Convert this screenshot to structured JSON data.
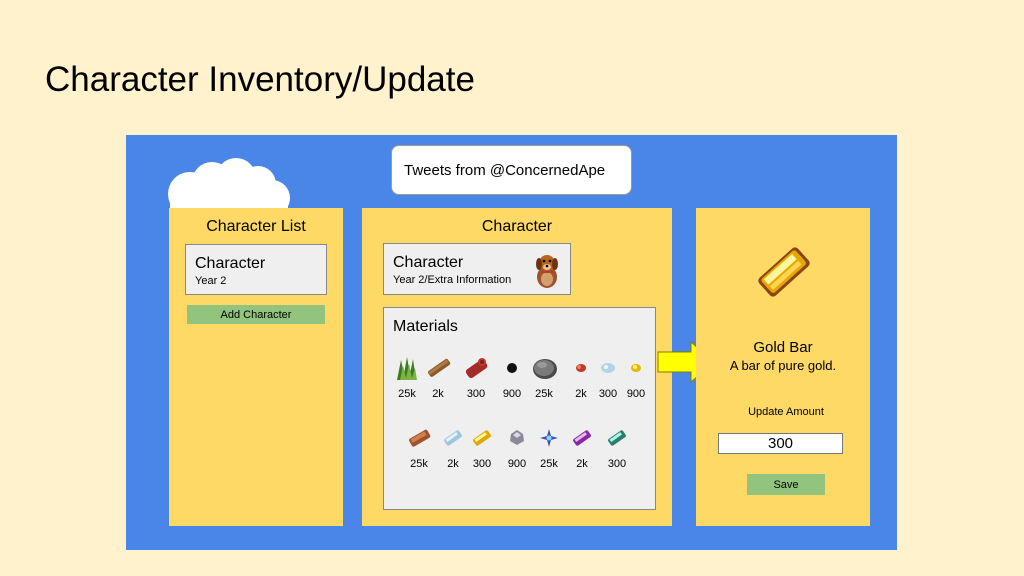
{
  "page": {
    "title": "Character Inventory/Update"
  },
  "tweets": {
    "label": "Tweets from @ConcernedApe"
  },
  "character_list": {
    "heading": "Character List",
    "card": {
      "name": "Character",
      "sub": "Year 2"
    },
    "add_button": "Add Character"
  },
  "character": {
    "heading": "Character",
    "card": {
      "name": "Character",
      "sub": "Year 2/Extra Information",
      "portrait_icon": "dog-icon"
    },
    "materials_title": "Materials",
    "materials_row1": [
      {
        "icon": "fiber-icon",
        "qty": "25k"
      },
      {
        "icon": "wood-icon",
        "qty": "2k"
      },
      {
        "icon": "hardwood-icon",
        "qty": "300"
      },
      {
        "icon": "coal-icon",
        "qty": "900"
      },
      {
        "icon": "stone-icon",
        "qty": "25k"
      },
      {
        "icon": "copper-ore-icon",
        "qty": "2k"
      },
      {
        "icon": "iron-ore-icon",
        "qty": "300"
      },
      {
        "icon": "gold-ore-icon",
        "qty": "900"
      }
    ],
    "materials_row2": [
      {
        "icon": "copper-bar-icon",
        "qty": "25k"
      },
      {
        "icon": "iron-bar-icon",
        "qty": "2k"
      },
      {
        "icon": "gold-bar-icon",
        "qty": "300"
      },
      {
        "icon": "refined-quartz-icon",
        "qty": "900"
      },
      {
        "icon": "battery-pack-icon",
        "qty": "25k"
      },
      {
        "icon": "iridium-bar-icon",
        "qty": "2k"
      },
      {
        "icon": "radioactive-bar-icon",
        "qty": "300"
      }
    ]
  },
  "item_detail": {
    "name": "Gold Bar",
    "description": "A bar of pure gold.",
    "update_label": "Update Amount",
    "amount": "300",
    "save_label": "Save",
    "icon": "gold-bar-icon"
  },
  "colors": {
    "background": "#fff2cc",
    "board": "#4a86e8",
    "panel": "#ffd966",
    "button": "#93c47d",
    "arrow": "#ffff00"
  }
}
